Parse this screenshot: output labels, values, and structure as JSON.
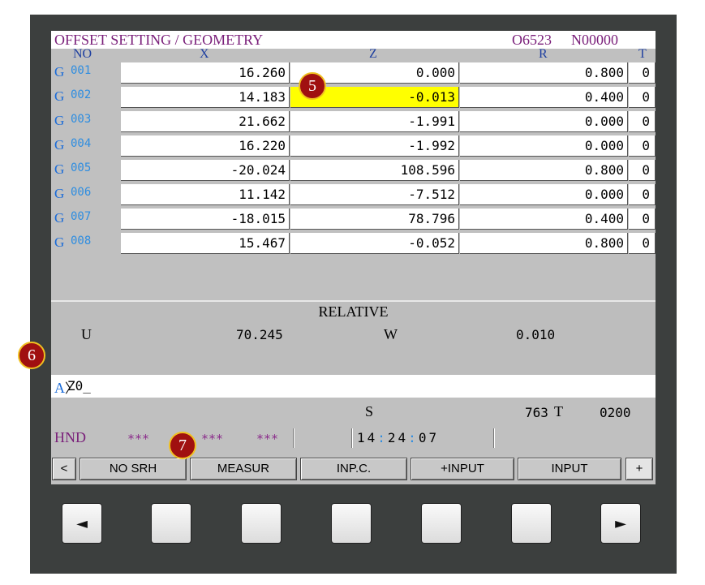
{
  "header": {
    "title": "OFFSET SETTING / GEOMETRY",
    "program": "O6523",
    "sequence": "N00000"
  },
  "columns": {
    "no": "NO",
    "x": "X",
    "z": "Z",
    "r": "R",
    "t": "T"
  },
  "rows": [
    {
      "g": "G",
      "no": "001",
      "x": "16.260",
      "z": "0.000",
      "r": "0.800",
      "t": "0"
    },
    {
      "g": "G",
      "no": "002",
      "x": "14.183",
      "z": "-0.013",
      "r": "0.400",
      "t": "0"
    },
    {
      "g": "G",
      "no": "003",
      "x": "21.662",
      "z": "-1.991",
      "r": "0.000",
      "t": "0"
    },
    {
      "g": "G",
      "no": "004",
      "x": "16.220",
      "z": "-1.992",
      "r": "0.000",
      "t": "0"
    },
    {
      "g": "G",
      "no": "005",
      "x": "-20.024",
      "z": "108.596",
      "r": "0.800",
      "t": "0"
    },
    {
      "g": "G",
      "no": "006",
      "x": "11.142",
      "z": "-7.512",
      "r": "0.000",
      "t": "0"
    },
    {
      "g": "G",
      "no": "007",
      "x": "-18.015",
      "z": "78.796",
      "r": "0.400",
      "t": "0"
    },
    {
      "g": "G",
      "no": "008",
      "x": "15.467",
      "z": "-0.052",
      "r": "0.800",
      "t": "0"
    }
  ],
  "relative": {
    "label": "RELATIVE",
    "u_label": "U",
    "u_value": "70.245",
    "w_label": "W",
    "w_value": "0.010"
  },
  "input_line": {
    "prompt": "A",
    "separator": "〉",
    "text": "Z0_"
  },
  "status": {
    "s_label": "S",
    "s_value": "763",
    "t_label": "T",
    "t_value": "0200"
  },
  "mode": {
    "mode": "HND",
    "alarm1": "***",
    "alarm2": "***",
    "alarm3": "***",
    "clock_h": "14",
    "clock_m": "24",
    "clock_s": "07",
    "clock_sep": ":"
  },
  "softkeys": {
    "left": "<",
    "k1": "NO SRH",
    "k2": "MEASUR",
    "k3": "INP.C.",
    "k4": "+INPUT",
    "k5": "INPUT",
    "right": "+"
  },
  "hardware_keys": {
    "left_arrow": "◄",
    "right_arrow": "►"
  },
  "callouts": {
    "c5": "5",
    "c6": "6",
    "c7": "7"
  },
  "colors": {
    "bezel": "#3c3f3e",
    "screen_bg": "#c0c0c0",
    "title": "#7a1f7a",
    "highlight": "#ffff00",
    "callout": "#a01010"
  }
}
